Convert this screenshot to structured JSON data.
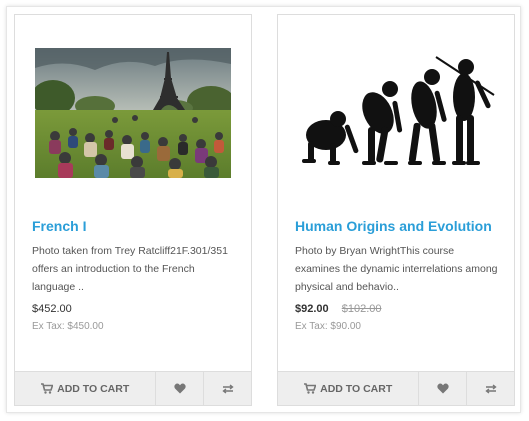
{
  "products": [
    {
      "title": "French I",
      "description": "Photo taken from Trey Ratcliff21F.301/351 offers an introduction to the French language ..",
      "price": "$452.00",
      "old_price": "",
      "ex_tax": "Ex Tax: $450.00",
      "image": "paris-eiffel-tower-picnic-photo"
    },
    {
      "title": "Human Origins and Evolution",
      "description": "Photo by Bryan WrightThis course examines the dynamic interrelations among physical and behavio..",
      "price": "$92.00",
      "old_price": "$102.00",
      "ex_tax": "Ex Tax: $90.00",
      "image": "human-evolution-silhouette"
    }
  ],
  "buttons": {
    "add_to_cart": "ADD TO CART",
    "cart_icon": "cart-icon",
    "wishlist_icon": "heart-icon",
    "compare_icon": "compare-arrows-icon"
  },
  "colors": {
    "title": "#2a9ed8",
    "button_bg": "#eeeeee",
    "border": "#dddddd"
  }
}
